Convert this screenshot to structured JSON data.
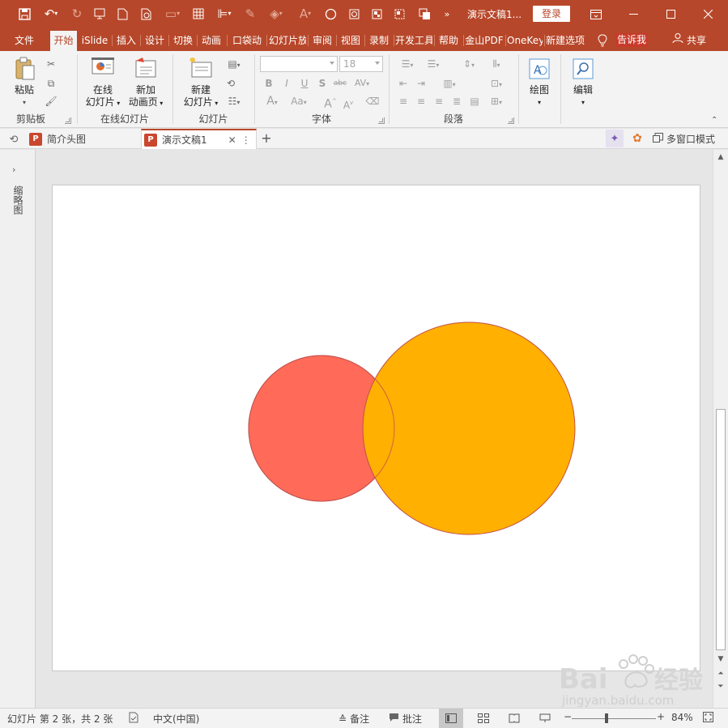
{
  "titlebar": {
    "doc_title": "演示文稿1...",
    "login_label": "登录"
  },
  "tabs": [
    {
      "label": "文件"
    },
    {
      "label": "开始"
    },
    {
      "label": "iSlide"
    },
    {
      "label": "插入"
    },
    {
      "label": "设计"
    },
    {
      "label": "切换"
    },
    {
      "label": "动画"
    },
    {
      "label": "口袋动"
    },
    {
      "label": "幻灯片放"
    },
    {
      "label": "审阅"
    },
    {
      "label": "视图"
    },
    {
      "label": "录制"
    },
    {
      "label": "开发工具"
    },
    {
      "label": "帮助"
    },
    {
      "label": "金山PDF"
    },
    {
      "label": "OneKey"
    },
    {
      "label": "新建选项"
    }
  ],
  "tellme": "告诉我",
  "share": "共享",
  "ribbon": {
    "clipboard": {
      "paste": "粘贴",
      "group": "剪贴板"
    },
    "online_slides": {
      "online": "在线",
      "online2": "幻灯片",
      "newanim": "新加",
      "newanim2": "动画页",
      "group": "在线幻灯片"
    },
    "slides": {
      "new": "新建",
      "new2": "幻灯片",
      "group": "幻灯片"
    },
    "font": {
      "font_name": "",
      "font_size": "18",
      "group": "字体"
    },
    "paragraph": {
      "group": "段落"
    },
    "drawing": {
      "label": "绘图"
    },
    "editing": {
      "label": "编辑"
    }
  },
  "doctabs": {
    "tab1": "简介头图",
    "tab2": "演示文稿1",
    "multiwindow": "多窗口模式"
  },
  "leftpane": {
    "label": "缩略图"
  },
  "slide": {
    "shapes": [
      {
        "name": "small-circle",
        "fill": "#ff6b58",
        "stroke": "#c0504d"
      },
      {
        "name": "large-circle",
        "fill": "#ffb000",
        "stroke": "#c0504d"
      }
    ]
  },
  "statusbar": {
    "slide_info": "幻灯片 第 2 张，共 2 张",
    "language": "中文(中国)",
    "notes": "备注",
    "comments": "批注",
    "zoom": "84%"
  },
  "colors": {
    "accent": "#b7472a",
    "ribbon": "#f3f3f3",
    "workspace": "#e6e6e6"
  }
}
